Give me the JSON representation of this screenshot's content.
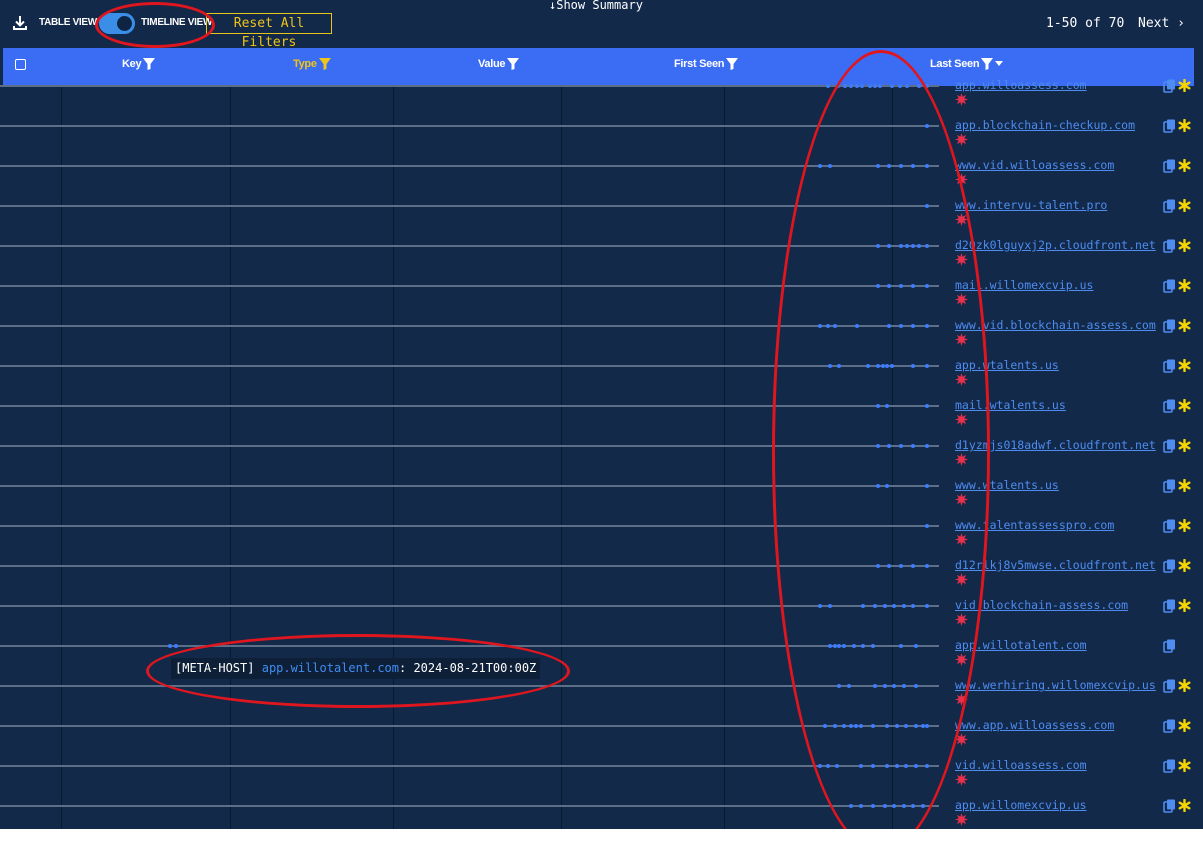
{
  "toolbar": {
    "download_icon": "download-icon",
    "table_view_label": "TABLE VIEW",
    "timeline_view_label": "TIMELINE VIEW",
    "reset_label": "Reset All Filters",
    "show_summary_label": "Show Summary",
    "pagination": "1-50 of 70",
    "next_label": "Next"
  },
  "header": {
    "columns": [
      "Key",
      "Type",
      "Value",
      "First Seen",
      "Last Seen"
    ],
    "active_filter_color": "#f0c419",
    "header_color": "#3b6cf4"
  },
  "colors": {
    "background": "#12294a",
    "dot": "#3d7bff",
    "link": "#4f8cf0",
    "star": "#f5d400",
    "burst": "#e8304c",
    "annotation": "#e0161f"
  },
  "rows": [
    {
      "host": "app.willoassess.com",
      "dots": [
        0.08,
        0.17,
        0.23,
        0.28,
        0.33,
        0.37,
        0.44,
        0.48,
        0.52,
        0.62,
        0.69,
        0.75,
        0.85,
        0.92
      ],
      "starred": true
    },
    {
      "host": "app.blockchain-checkup.com",
      "dots": [
        0.92
      ],
      "starred": true
    },
    {
      "host": "www.vid.willoassess.com",
      "dots": [
        0.02,
        0.1,
        0.5,
        0.6,
        0.7,
        0.8,
        0.92
      ],
      "starred": true
    },
    {
      "host": "www.intervu-talent.pro",
      "dots": [
        0.92
      ],
      "starred": true
    },
    {
      "host": "d20zk0lguyxj2p.cloudfront.net",
      "dots": [
        0.5,
        0.6,
        0.7,
        0.75,
        0.8,
        0.85,
        0.92
      ],
      "starred": true
    },
    {
      "host": "mail.willomexcvip.us",
      "dots": [
        0.5,
        0.6,
        0.7,
        0.8,
        0.92
      ],
      "starred": true
    },
    {
      "host": "www.vid.blockchain-assess.com",
      "dots": [
        0.02,
        0.08,
        0.14,
        0.33,
        0.6,
        0.7,
        0.8,
        0.92
      ],
      "starred": true
    },
    {
      "host": "app.wtalents.us",
      "dots": [
        0.1,
        0.18,
        0.42,
        0.5,
        0.55,
        0.58,
        0.62,
        0.8,
        0.92
      ],
      "starred": true
    },
    {
      "host": "mail.wtalents.us",
      "dots": [
        0.5,
        0.58,
        0.92
      ],
      "starred": true
    },
    {
      "host": "d1yzmjs018adwf.cloudfront.net",
      "dots": [
        0.5,
        0.6,
        0.7,
        0.8,
        0.92
      ],
      "starred": true
    },
    {
      "host": "www.wtalents.us",
      "dots": [
        0.5,
        0.58,
        0.92
      ],
      "starred": true
    },
    {
      "host": "www.talentassesspro.com",
      "dots": [
        0.92
      ],
      "starred": true
    },
    {
      "host": "d12rlkj8v5mwse.cloudfront.net",
      "dots": [
        0.5,
        0.6,
        0.7,
        0.8,
        0.92
      ],
      "starred": true
    },
    {
      "host": "vid.blockchain-assess.com",
      "dots": [
        0.02,
        0.1,
        0.38,
        0.48,
        0.56,
        0.64,
        0.72,
        0.8,
        0.92
      ],
      "starred": true
    },
    {
      "host": "app.willotalent.com",
      "dots": [
        0.1,
        0.14,
        0.18,
        0.22,
        0.3,
        0.38,
        0.46,
        0.7,
        0.82
      ],
      "starred": false,
      "extra_dots": [
        0.02,
        0.08
      ]
    },
    {
      "host": "www.werhiring.willomexcvip.us",
      "dots": [
        0.18,
        0.26,
        0.48,
        0.56,
        0.64,
        0.72,
        0.82
      ],
      "starred": true
    },
    {
      "host": "www.app.willoassess.com",
      "dots": [
        0.06,
        0.14,
        0.22,
        0.28,
        0.32,
        0.36,
        0.46,
        0.58,
        0.66,
        0.74,
        0.82,
        0.88,
        0.92
      ],
      "starred": true
    },
    {
      "host": "vid.willoassess.com",
      "dots": [
        0.02,
        0.08,
        0.16,
        0.36,
        0.46,
        0.58,
        0.66,
        0.74,
        0.82,
        0.92
      ],
      "starred": true
    },
    {
      "host": "app.willomexcvip.us",
      "dots": [
        0.28,
        0.36,
        0.46,
        0.56,
        0.64,
        0.72,
        0.8,
        0.88
      ],
      "starred": true
    }
  ],
  "tooltip": {
    "prefix": "[META-HOST]",
    "host": "app.willotalent.com",
    "suffix": ": 2024-08-21T00:00Z"
  }
}
